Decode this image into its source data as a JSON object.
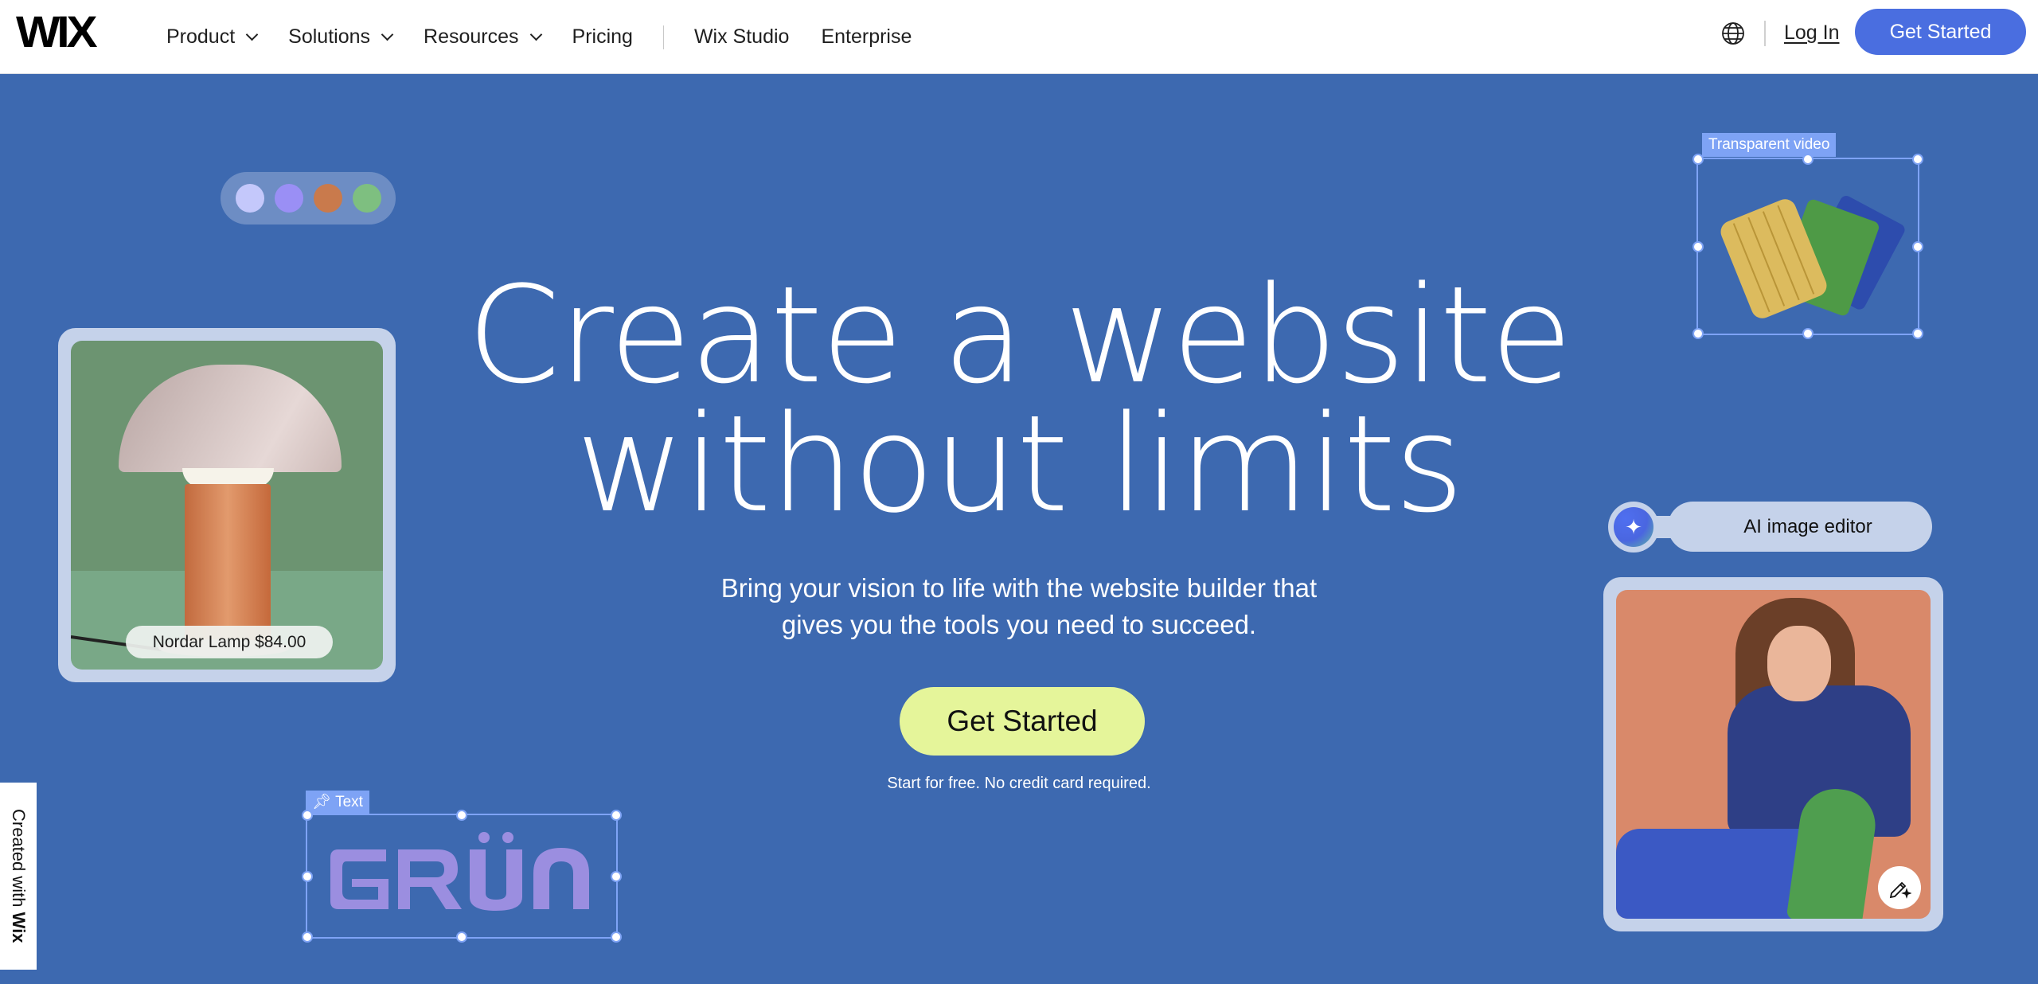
{
  "header": {
    "logo": "WIX",
    "nav": [
      {
        "label": "Product",
        "dropdown": true
      },
      {
        "label": "Solutions",
        "dropdown": true
      },
      {
        "label": "Resources",
        "dropdown": true
      },
      {
        "label": "Pricing",
        "dropdown": false
      },
      {
        "label": "Wix Studio",
        "dropdown": false
      },
      {
        "label": "Enterprise",
        "dropdown": false
      }
    ],
    "language_icon": "globe-icon",
    "login_label": "Log In",
    "cta_label": "Get Started",
    "cta_color": "#4a6ee0"
  },
  "hero": {
    "headline_line1": "Create a website",
    "headline_line2": "without limits",
    "subtitle_line1": "Bring your vision to life with the website builder that",
    "subtitle_line2": "gives you the tools you need to succeed.",
    "cta_label": "Get Started",
    "cta_color": "#e5f59a",
    "note": "Start for free. No credit card required.",
    "background_color": "#3d69b0"
  },
  "swatches": [
    "#c4c8fb",
    "#9a8ff5",
    "#c97a4c",
    "#7ebf80"
  ],
  "lamp_card": {
    "tag": "Nordar Lamp $84.00"
  },
  "video_element": {
    "label": "Transparent video"
  },
  "ai_editor": {
    "label": "AI image editor",
    "icon": "sparkle-icon",
    "edit_icon": "pencil-sparkle-icon"
  },
  "text_element": {
    "label": "Text",
    "icon": "pin-icon",
    "content": "GRÜN",
    "color": "#9b8ee0"
  },
  "badge": {
    "prefix": "Created with ",
    "brand": "Wix"
  }
}
